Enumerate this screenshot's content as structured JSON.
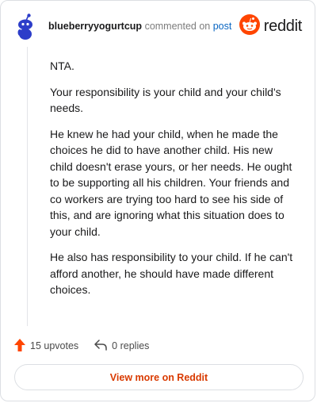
{
  "header": {
    "username": "blueberryyogurtcup",
    "commented_text": "commented on",
    "post_link": "post",
    "brand": "reddit",
    "avatar_icon": "snoo-avatar-icon",
    "brand_icon": "reddit-logo-icon",
    "brand_color": "#ff4500"
  },
  "comment": {
    "paragraphs": [
      "NTA.",
      "Your responsibility is your child and your child's needs.",
      "He knew he had your child, when he made the choices he did to have another child. His new child doesn't erase yours, or her needs. He ought to be supporting all his children. Your friends and co workers are trying too hard to see his side of this, and are ignoring what this situation does to your child.",
      "He also has responsibility to your child. If he can't afford another, he should have made different choices."
    ]
  },
  "footer": {
    "upvotes_label": "15 upvotes",
    "replies_label": "0 replies",
    "upvote_icon": "upvote-arrow-icon",
    "reply_icon": "reply-arrow-icon"
  },
  "actions": {
    "view_more_label": "View more on Reddit"
  }
}
